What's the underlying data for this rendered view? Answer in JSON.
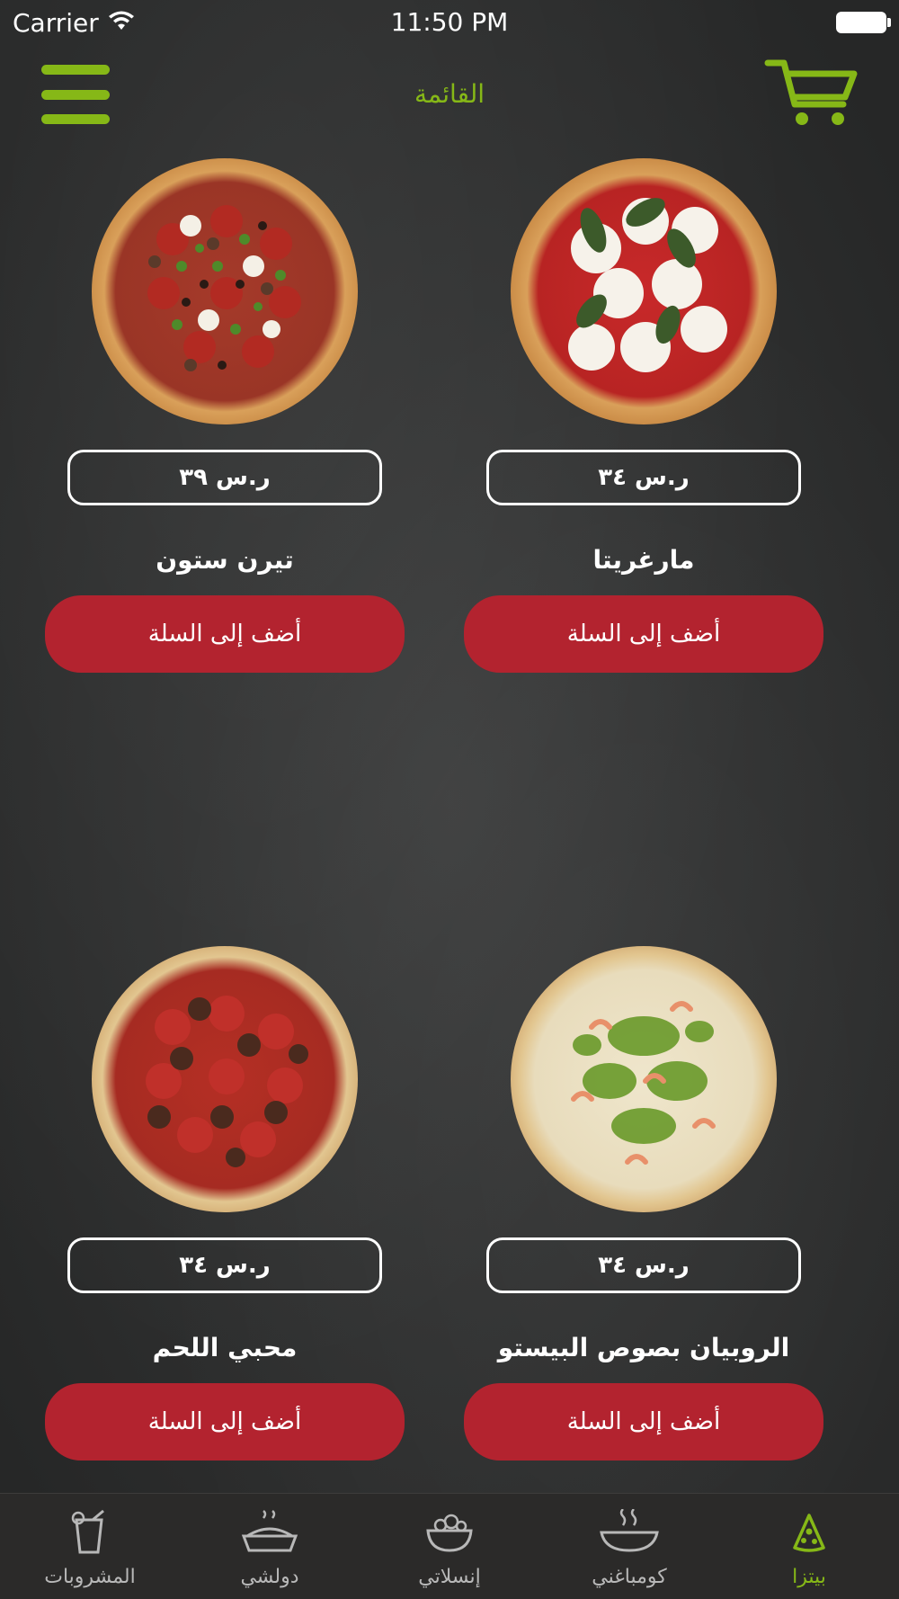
{
  "status_bar": {
    "carrier": "Carrier",
    "time": "11:50 PM"
  },
  "nav": {
    "title": "القائمة",
    "menu_icon": "hamburger-menu-icon",
    "cart_icon": "cart-icon"
  },
  "products": [
    {
      "name": "مارغريتا",
      "price": "ر.س ٣٤",
      "add_label": "أضف إلى السلة",
      "image": "margherita-pizza"
    },
    {
      "name": "تيرن ستون",
      "price": "ر.س ٣٩",
      "add_label": "أضف إلى السلة",
      "image": "terrenstone-pizza"
    },
    {
      "name": "الروبيان بصوص البيستو",
      "price": "ر.س ٣٤",
      "add_label": "أضف إلى السلة",
      "image": "shrimp-pesto-pizza"
    },
    {
      "name": "محبي اللحم",
      "price": "ر.س ٣٤",
      "add_label": "أضف إلى السلة",
      "image": "meat-lovers-pizza"
    }
  ],
  "tabs": [
    {
      "label": "بيتزا",
      "icon": "pizza-slice-icon",
      "active": true
    },
    {
      "label": "كومباغني",
      "icon": "bowl-icon",
      "active": false
    },
    {
      "label": "إنسلاتي",
      "icon": "salad-icon",
      "active": false
    },
    {
      "label": "دولشي",
      "icon": "dessert-icon",
      "active": false
    },
    {
      "label": "المشروبات",
      "icon": "drink-icon",
      "active": false
    }
  ],
  "colors": {
    "accent_green": "#86b817",
    "button_red": "#b3232f",
    "background": "#2f3030"
  }
}
